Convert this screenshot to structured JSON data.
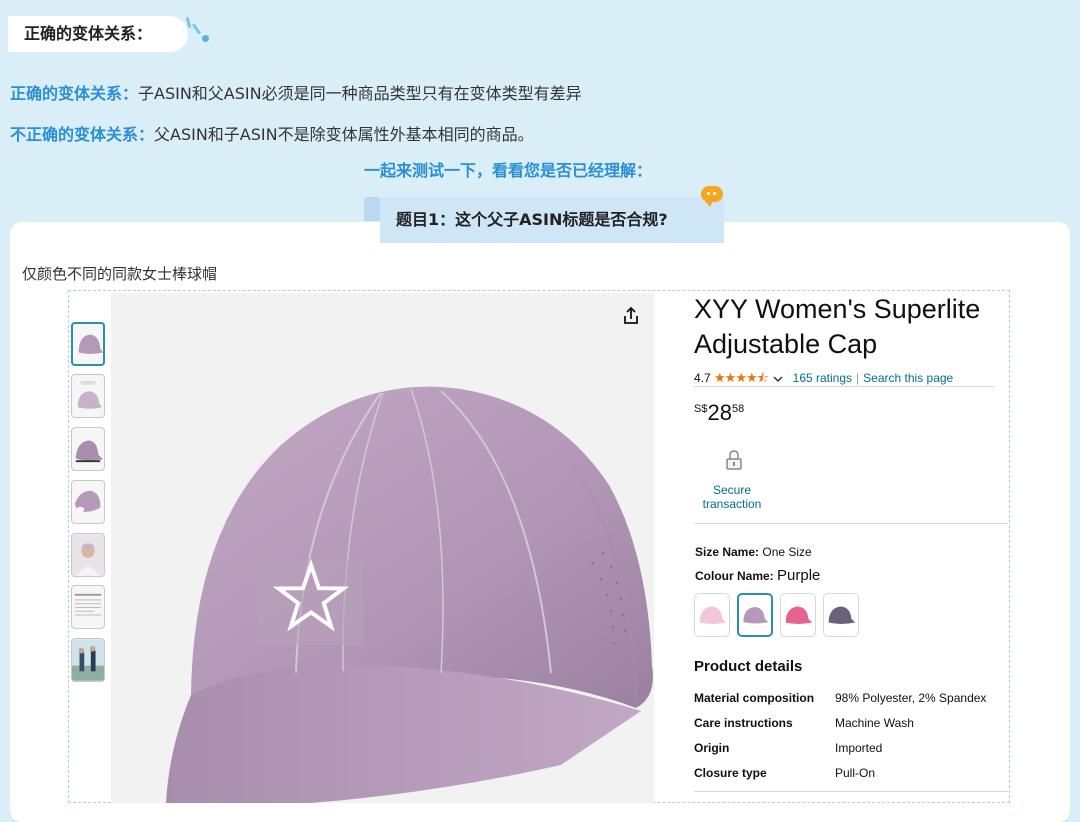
{
  "header": {
    "title": "正确的变体关系："
  },
  "rules": {
    "correct_label": "正确的变体关系：",
    "correct_text": "子ASIN和父ASIN必须是同一种商品类型只有在变体类型有差异",
    "incorrect_label": "不正确的变体关系：",
    "incorrect_text": "父ASIN和子ASIN不是除变体属性外基本相同的商品。"
  },
  "invite": "一起来测试一下，看看您是否已经理解：",
  "question": "题目1：这个父子ASIN标题是否合规?",
  "card": {
    "subtitle": "仅颜色不同的同款女士棒球帽"
  },
  "product": {
    "title": "XYY Women's Superlite Adjustable Cap",
    "rating_value": "4.7",
    "stars": "★★★★⯪",
    "ratings_link": "165 ratings",
    "search_link": "Search this page",
    "price_currency": "S$",
    "price_whole": "28",
    "price_fraction": "58",
    "secure_label": "Secure transaction",
    "size_label": "Size Name:",
    "size_value": "One Size",
    "colour_label": "Colour Name:",
    "colour_value": "Purple",
    "swatches": [
      "light-pink",
      "purple",
      "pink",
      "dark-purple"
    ],
    "details_heading": "Product details",
    "details": [
      {
        "key": "Material composition",
        "value": "98% Polyester, 2% Spandex"
      },
      {
        "key": "Care instructions",
        "value": "Machine Wash"
      },
      {
        "key": "Origin",
        "value": "Imported"
      },
      {
        "key": "Closure type",
        "value": "Pull-On"
      }
    ]
  },
  "icons": {
    "share": "share-icon",
    "lock": "lock-icon",
    "dropdown": "chevron-down-icon",
    "chat": "chat-bubble-icon"
  },
  "colors": {
    "accent_blue": "#2b8fd6",
    "background": "#daeef8",
    "link": "#007185",
    "star": "#e77600",
    "cap_purple": "#b49ab8"
  }
}
